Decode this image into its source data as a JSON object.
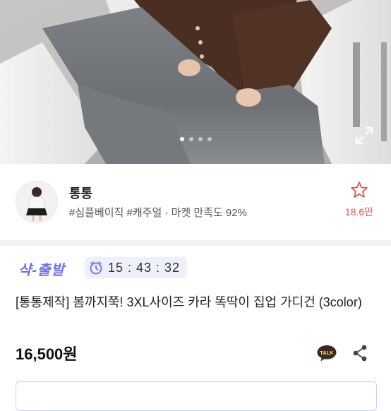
{
  "hero": {
    "image": "product-photo-brown-cardigan-gray-jeans",
    "carousel_dots": 4,
    "active_dot": 0
  },
  "seller": {
    "name": "통통",
    "tags": "#심플베이직 #캐주얼 · 마켓 만족도 92%",
    "likes": "18.6만",
    "like_icon": "star-outline-icon",
    "accent": "#e6504f"
  },
  "sale": {
    "badge": "샥-출발",
    "timer": "15 : 43 : 32",
    "badge_color": "#6f6ff0"
  },
  "product": {
    "title": "[통통제작] 봄까지쭉! 3XL사이즈 카라 똑딱이 집업 가디건 (3color)",
    "price": "16,500원"
  },
  "actions": {
    "talk_label": "TALK",
    "share_icon": "share-icon"
  }
}
